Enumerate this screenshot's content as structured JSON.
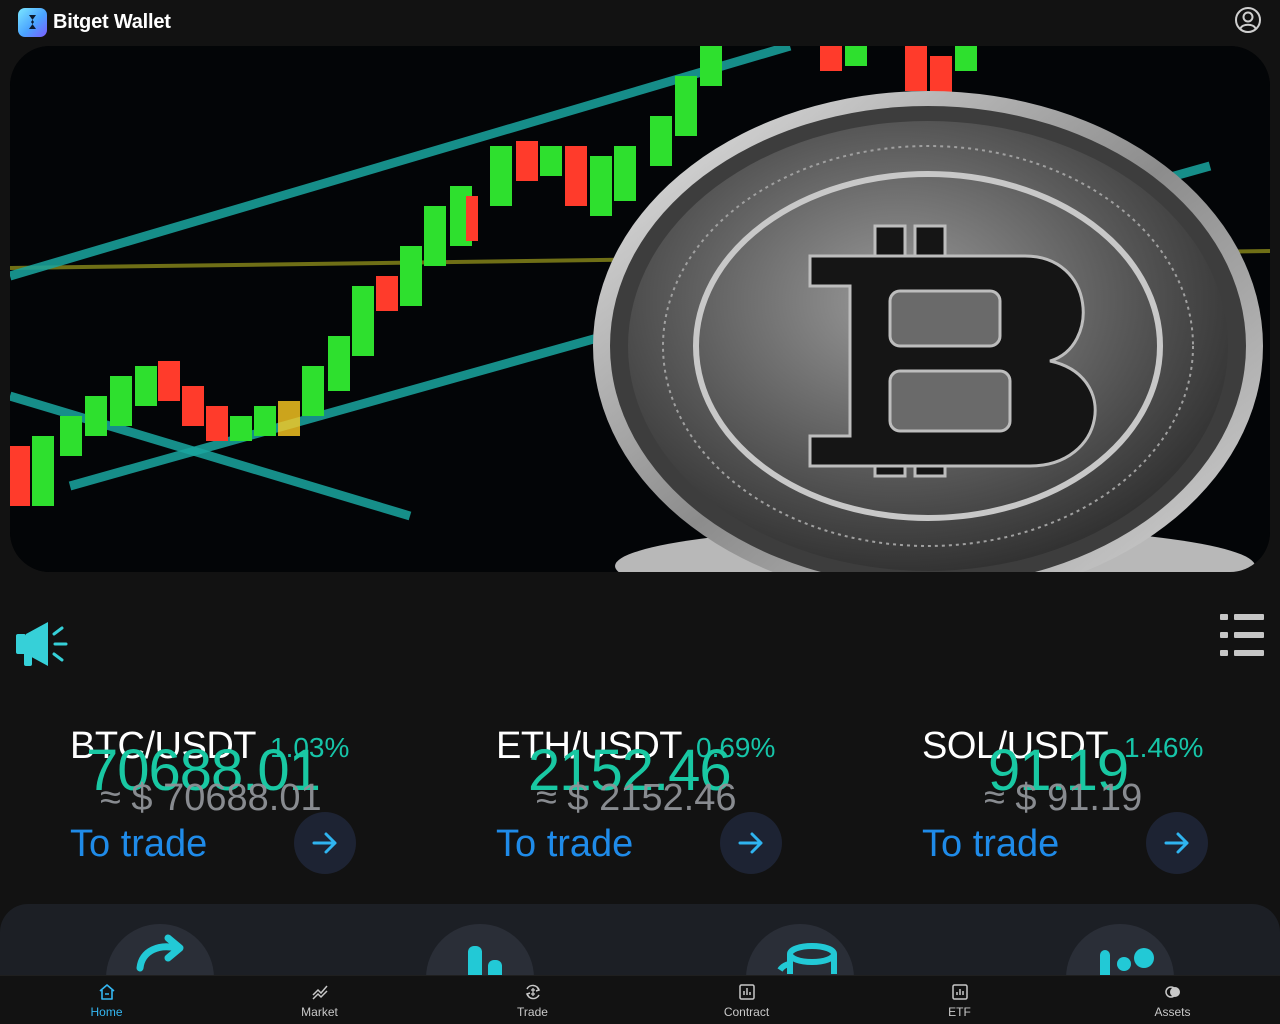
{
  "header": {
    "brand_name": "Bitget Wallet",
    "logo_icon": "bitget-logo-icon",
    "user_icon": "user-circle-icon"
  },
  "banner": {
    "image": "bitcoin-coin-candlestick-chart"
  },
  "notice": {
    "icon": "megaphone-icon",
    "menu_icon": "list-menu-icon"
  },
  "tickers": [
    {
      "pair": "BTC/USDT",
      "change": "1.03%",
      "price": "70688.01",
      "usd": "≈ $ 70688.01",
      "trade_label": "To trade"
    },
    {
      "pair": "ETH/USDT",
      "change": "0.69%",
      "price": "2152.46",
      "usd": "≈ $ 2152.46",
      "trade_label": "To trade"
    },
    {
      "pair": "SOL/USDT",
      "change": "1.46%",
      "price": "91.19",
      "usd": "≈ $ 91.19",
      "trade_label": "To trade"
    }
  ],
  "features": [
    "convert-icon",
    "chart-bars-icon",
    "coins-stack-icon",
    "dots-icon"
  ],
  "nav": {
    "items": [
      {
        "label": "Home",
        "icon": "home-icon",
        "active": true
      },
      {
        "label": "Market",
        "icon": "market-icon",
        "active": false
      },
      {
        "label": "Trade",
        "icon": "trade-icon",
        "active": false
      },
      {
        "label": "Contract",
        "icon": "contract-icon",
        "active": false
      },
      {
        "label": "ETF",
        "icon": "etf-icon",
        "active": false
      },
      {
        "label": "Assets",
        "icon": "assets-icon",
        "active": false
      }
    ]
  },
  "colors": {
    "accent_green": "#19c8a3",
    "link_blue": "#1f8be9",
    "nav_active": "#34b7f2",
    "background": "#121212"
  }
}
